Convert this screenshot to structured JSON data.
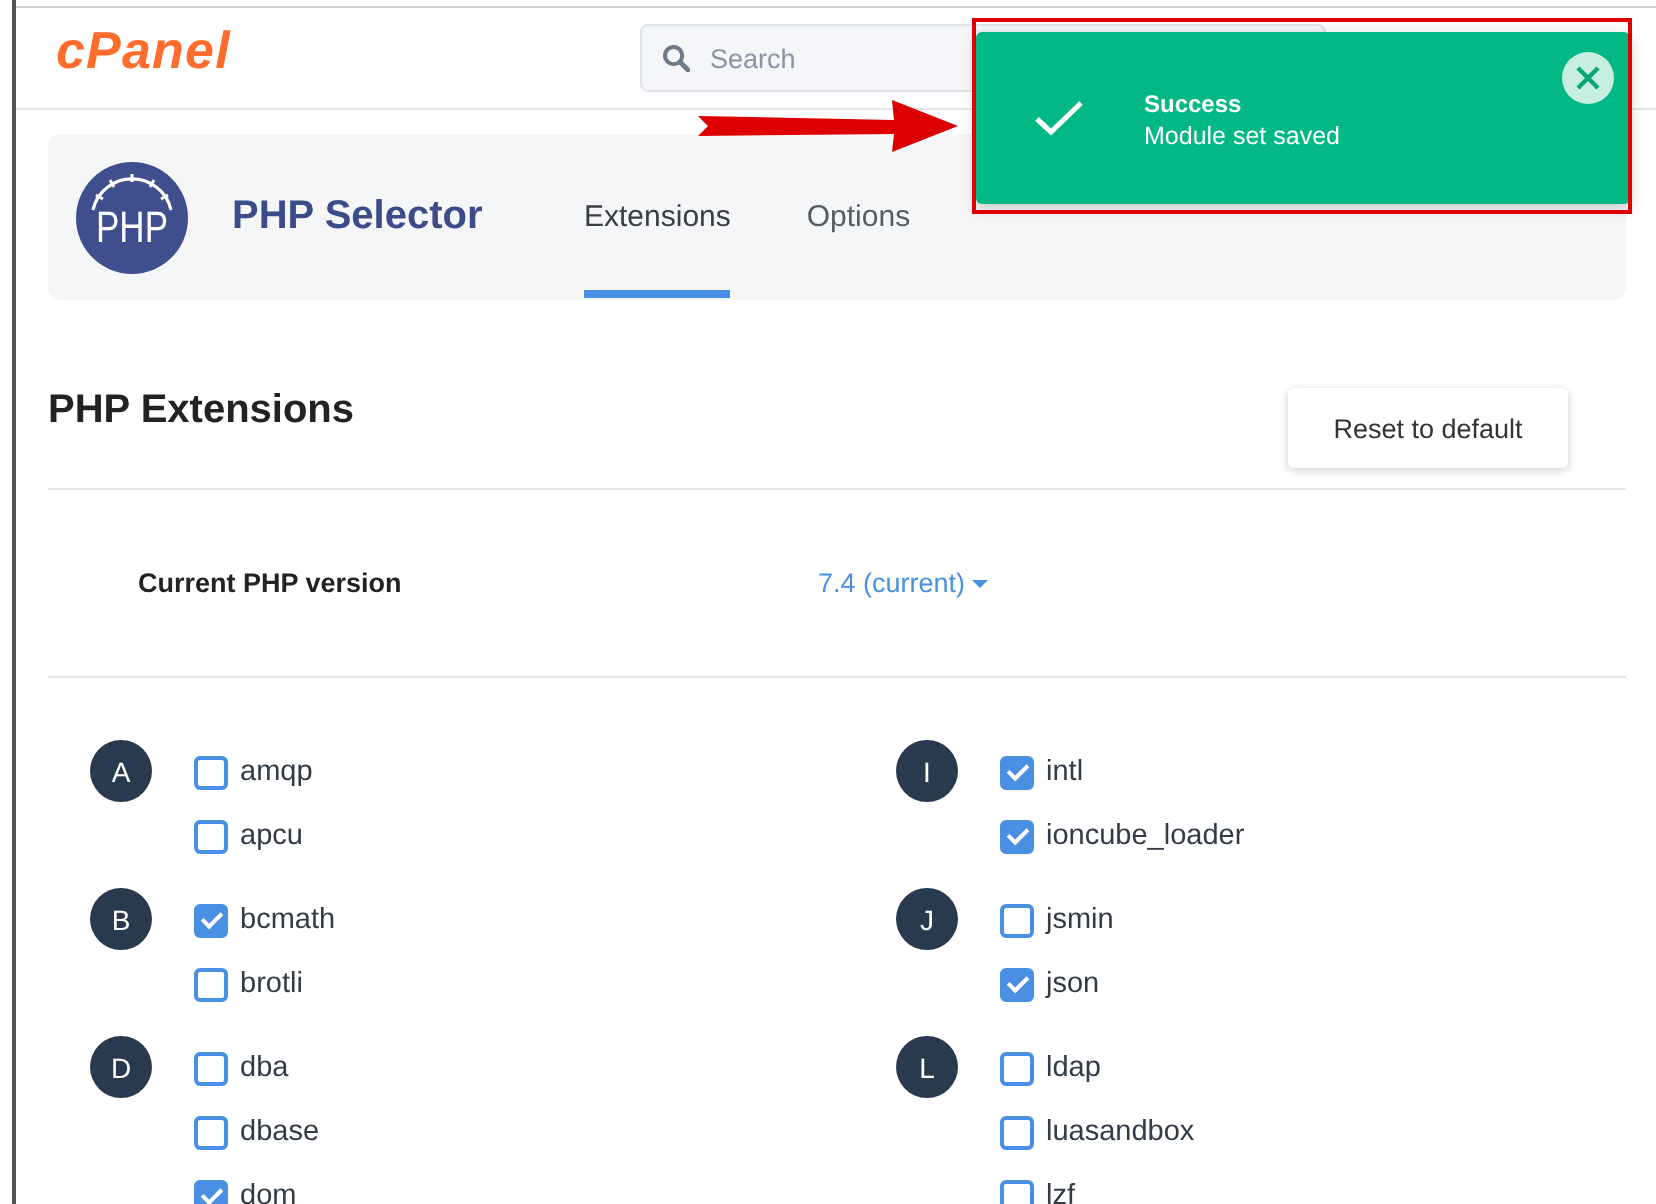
{
  "header": {
    "logo": "cPanel",
    "search": {
      "placeholder": "Search"
    }
  },
  "notification": {
    "kind": "success",
    "title": "Success",
    "message": "Module set saved"
  },
  "app_header": {
    "logo_text": "PHP",
    "title": "PHP Selector",
    "tabs": [
      {
        "label": "Extensions",
        "selected": true
      },
      {
        "label": "Options",
        "selected": false
      }
    ]
  },
  "extensions": {
    "title": "PHP Extensions",
    "reset_button": "Reset to default",
    "version_label": "Current PHP version",
    "version_value": "7.4 (current)",
    "columns": [
      {
        "groups": [
          {
            "letter": "A",
            "items": [
              {
                "name": "amqp",
                "checked": false
              },
              {
                "name": "apcu",
                "checked": false
              }
            ]
          },
          {
            "letter": "B",
            "items": [
              {
                "name": "bcmath",
                "checked": true
              },
              {
                "name": "brotli",
                "checked": false
              }
            ]
          },
          {
            "letter": "D",
            "items": [
              {
                "name": "dba",
                "checked": false
              },
              {
                "name": "dbase",
                "checked": false
              },
              {
                "name": "dom",
                "checked": true
              }
            ]
          }
        ]
      },
      {
        "groups": [
          {
            "letter": "I",
            "items": [
              {
                "name": "intl",
                "checked": true
              },
              {
                "name": "ioncube_loader",
                "checked": true
              }
            ]
          },
          {
            "letter": "J",
            "items": [
              {
                "name": "jsmin",
                "checked": false
              },
              {
                "name": "json",
                "checked": true
              }
            ]
          },
          {
            "letter": "L",
            "items": [
              {
                "name": "ldap",
                "checked": false
              },
              {
                "name": "luasandbox",
                "checked": false
              },
              {
                "name": "lzf",
                "checked": false
              }
            ]
          }
        ]
      }
    ]
  }
}
